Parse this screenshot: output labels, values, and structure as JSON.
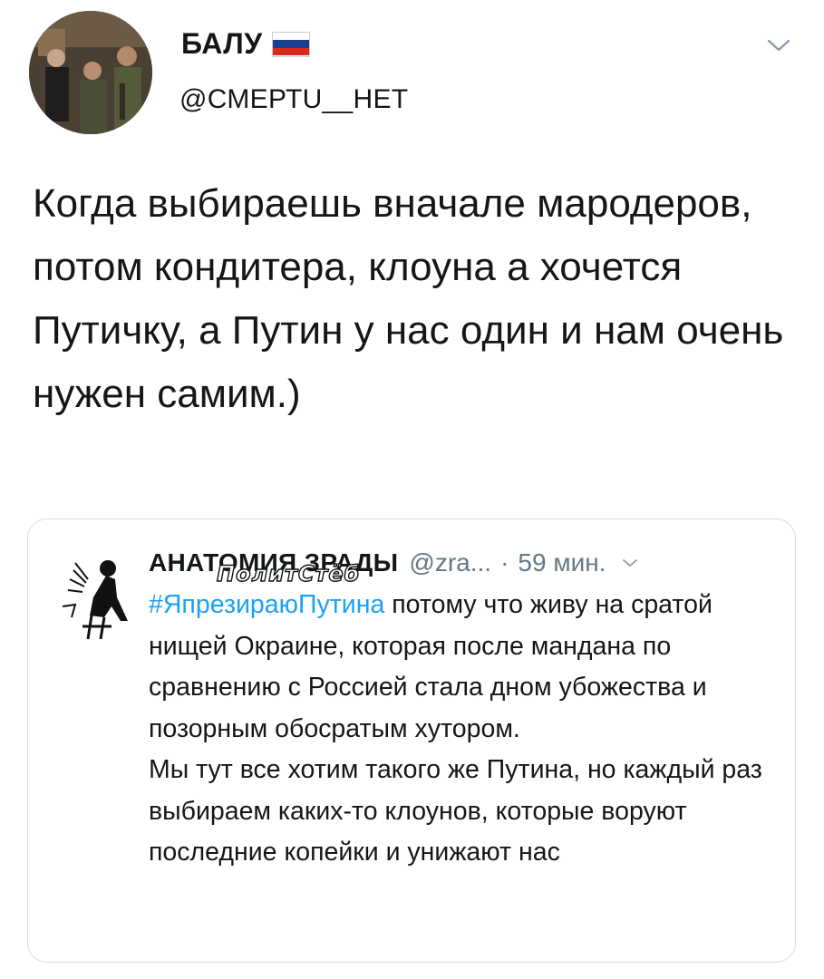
{
  "tweet": {
    "author_name": "БАЛУ",
    "author_handle": "@СМЕРТU__НЕТ",
    "flag_colors": [
      "#ffffff",
      "#1c3f94",
      "#d52b1e"
    ],
    "avatar_icon": "group-photo-avatar",
    "menu_icon": "chevron-down-icon",
    "text": "Когда выбираешь вначале мародеров, потом кондитера, клоуна а хочется Путичку, а Путин у нас один и нам очень нужен самим.)"
  },
  "quote": {
    "author_name": "АНАТОМИЯ ЗРАДЫ",
    "author_handle": "@zra...",
    "separator": "·",
    "time": "59 мин.",
    "avatar_icon": "silhouette-avatar",
    "menu_icon": "chevron-down-icon",
    "hashtag": "#ЯпрезираюПутина",
    "text_after_hashtag": " потому что живу на сратой нищей Окраине, которая после мандана по сравнению с Россией стала дном убожества и позорным обосратым хутором.",
    "text_second": "Мы тут все хотим такого же Путина, но каждый раз выбираем каких-то клоунов, которые воруют последние копейки и унижают нас",
    "hashtag_color": "#1da1f2"
  },
  "watermark": {
    "text": "ПолитСтёб"
  }
}
